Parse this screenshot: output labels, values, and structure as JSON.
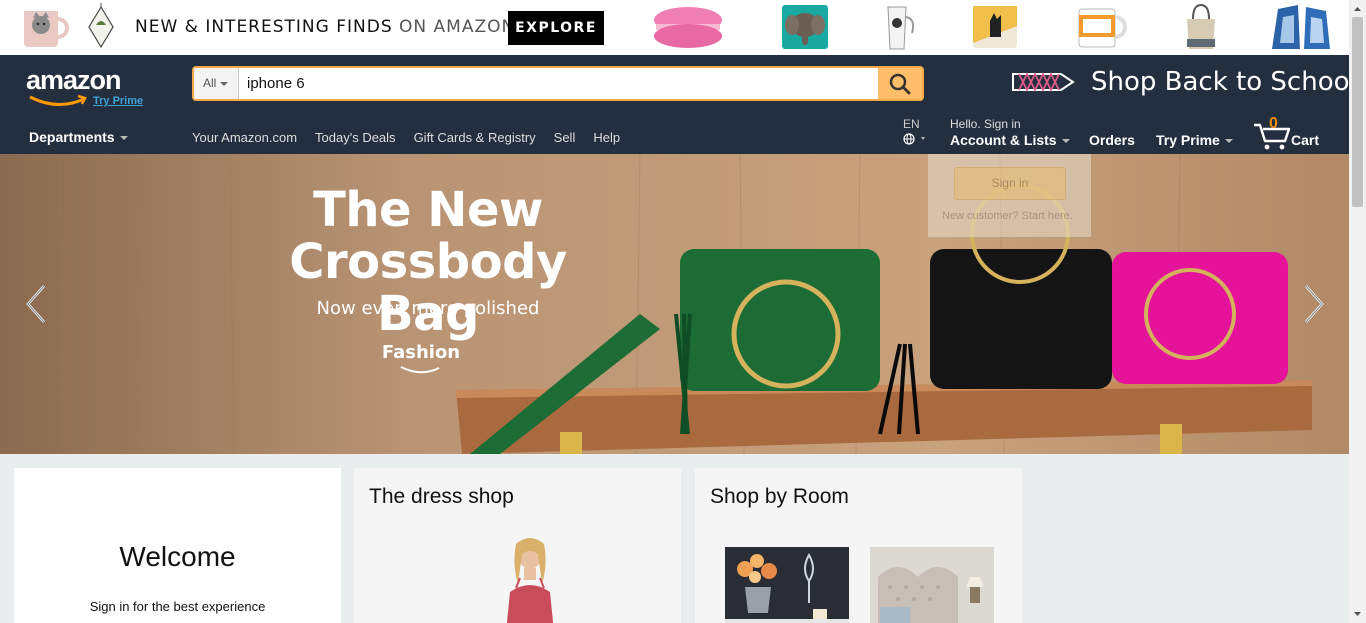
{
  "promo": {
    "headline_bold": "NEW & INTERESTING FINDS",
    "headline_light": "ON AMAZON",
    "explore_label": "EXPLORE",
    "product_icons": [
      "cat-mug-icon",
      "pyramid-planter-icon",
      "macaron-pillow-icon",
      "elephant-pillow-icon",
      "cat-tumbler-icon",
      "cat-pillow-icon",
      "pill-bottle-mug-icon",
      "lunch-bag-icon",
      "geode-bookends-icon"
    ]
  },
  "header": {
    "logo_text": "amazon",
    "logo_prime": "Try Prime",
    "search": {
      "category": "All",
      "value": "iphone 6"
    },
    "school_banner": "Shop Back to School",
    "departments_label": "Departments",
    "nav_links": [
      "Your Amazon.com",
      "Today's Deals",
      "Gift Cards & Registry",
      "Sell",
      "Help"
    ],
    "language": "EN",
    "account_hello": "Hello. Sign in",
    "account_main": "Account & Lists",
    "orders_label": "Orders",
    "try_prime_label": "Try Prime",
    "cart_count": "0",
    "cart_label": "Cart"
  },
  "hero": {
    "title_line1": "The New",
    "title_line2": "Crossbody Bag",
    "subtitle": "Now even more polished",
    "brand": "Fashion",
    "colors": {
      "wood": "#b7916c",
      "bag_green": "#1d6b35",
      "bag_black": "#141414",
      "bag_pink": "#e5129a"
    }
  },
  "signin_flyout": {
    "button_label": "Sign in",
    "new_customer_text": "New customer?",
    "start_here_link": "Start here."
  },
  "cards": {
    "welcome": {
      "title": "Welcome",
      "subtitle": "Sign in for the best experience"
    },
    "dress_shop": {
      "title": "The dress shop"
    },
    "shop_by_room": {
      "title": "Shop by Room"
    }
  },
  "colors": {
    "header_bg": "#232f3e",
    "search_button": "#febd69",
    "cart_count": "#f08804",
    "link_blue": "#41a2d8"
  }
}
